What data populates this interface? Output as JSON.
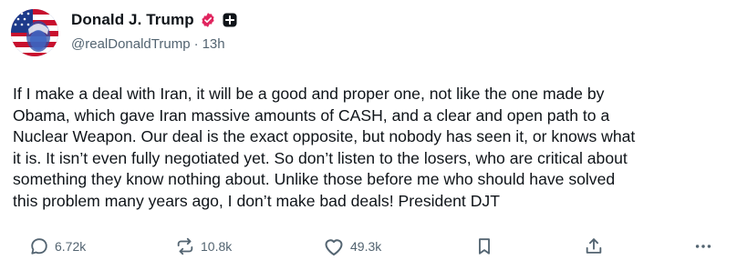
{
  "author": {
    "display_name": "Donald J. Trump",
    "handle": "@realDonaldTrump",
    "separator": "·",
    "time": "13h"
  },
  "post": {
    "text": "If I make a deal with Iran, it will be a good and proper one, not like the one made by\nObama, which gave Iran massive amounts of CASH, and a clear and open path to a\nNuclear Weapon. Our deal is the exact opposite, but nobody has seen it, or knows what\nit is. It isn’t even fully negotiated yet. So don’t listen to the losers, who are critical about\nsomething they know nothing about. Unlike those before me who should have solved\nthis problem many years ago, I don’t make bad deals! President DJT"
  },
  "actions": {
    "replies": "6.72k",
    "reposts": "10.8k",
    "likes": "49.3k"
  },
  "icons": {
    "verified": "verified-badge-icon",
    "plus": "plus-badge-icon",
    "reply": "reply-icon",
    "repost": "repost-icon",
    "like": "heart-icon",
    "bookmark": "bookmark-icon",
    "share": "share-icon",
    "more": "more-icon"
  },
  "colors": {
    "text": "#0f1419",
    "secondary": "#536471",
    "verified_pink": "#e0245e",
    "badge_dark": "#0f1419"
  }
}
